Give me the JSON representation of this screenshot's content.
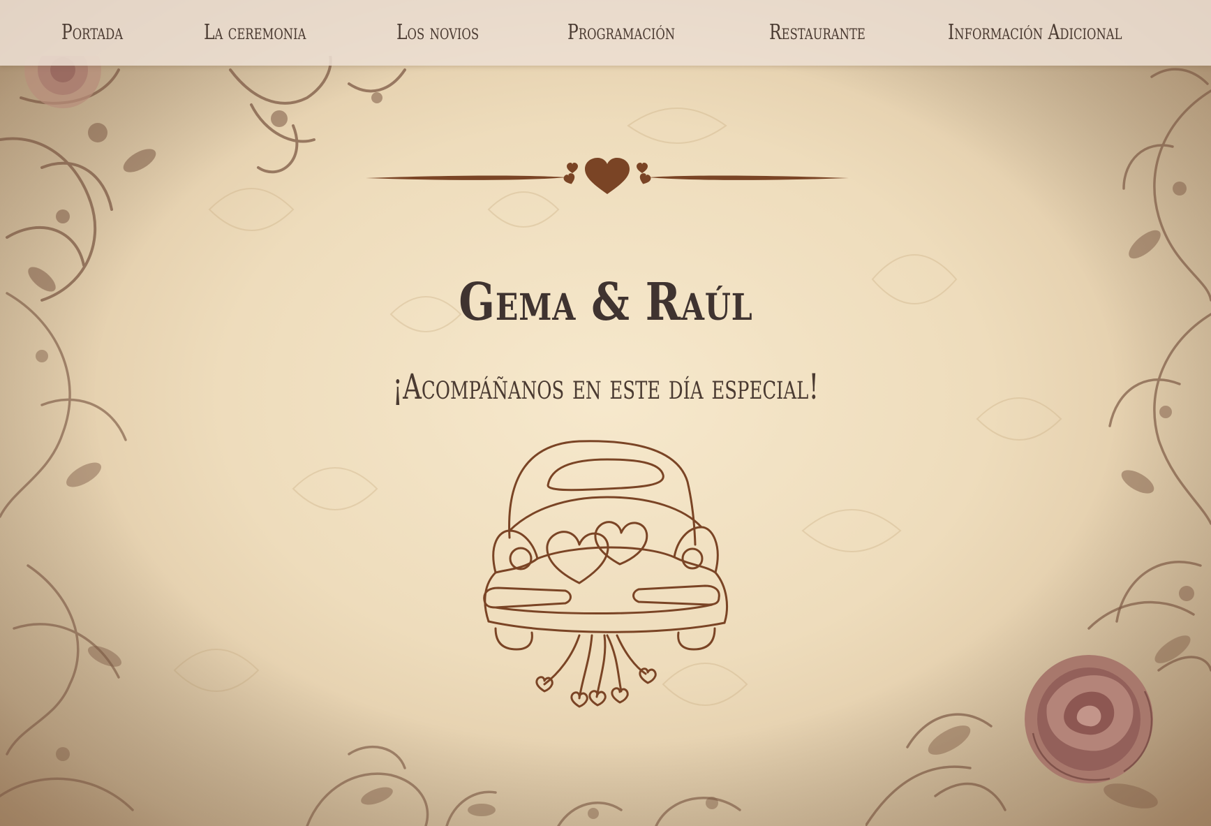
{
  "nav": {
    "items": [
      {
        "label": "Portada"
      },
      {
        "label": "La ceremonia"
      },
      {
        "label": "Los novios"
      },
      {
        "label": "Programación"
      },
      {
        "label": "Restaurante"
      },
      {
        "label": "Información Adicional"
      }
    ]
  },
  "hero": {
    "couple_names": "Gema & Raúl",
    "tagline": "¡Acompáñanos en este día especial!"
  },
  "colors": {
    "accent": "#7a4425",
    "text": "#3f3330",
    "nav_bg": "#ecded2",
    "paper": "#efdfc2"
  },
  "icons": {
    "divider": "heart-divider-icon",
    "car": "wedding-car-icon",
    "rose": "rose-ornament"
  }
}
